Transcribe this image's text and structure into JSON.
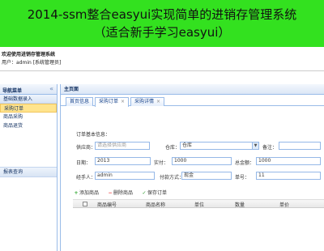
{
  "banner": {
    "line1": "2014-ssm整合easyui实现简单的进销存管理系统",
    "line2": "（适合新手学习easyui）"
  },
  "header": {
    "system_title": "欢迎使用进销存管理系统",
    "user_line": "用户：admin  [系统管理员]"
  },
  "sidebar": {
    "title": "导航菜单",
    "collapse_icon": "«",
    "items": [
      {
        "label": "基础数据录入",
        "group": true
      },
      {
        "label": "采购订单",
        "active": true
      },
      {
        "label": "商品采购"
      },
      {
        "label": "商品退货"
      }
    ],
    "bottom_group": "报表查询"
  },
  "main": {
    "title": "主页面",
    "tabs": [
      {
        "label": "首页信息"
      },
      {
        "label": "采购订单",
        "close": "×",
        "selected": true
      },
      {
        "label": "采购详情",
        "close": "×"
      }
    ]
  },
  "form": {
    "legend": "订单基本信息：",
    "supplier_label": "供应商：",
    "supplier_placeholder": "请选择供应商",
    "warehouse_label": "仓库：",
    "warehouse_value": "仓库",
    "remark_label": "备注：",
    "date_label": "日期：",
    "date_value": "2013",
    "payment_label": "实付：",
    "payment_value": "1000",
    "total_label": "总金额：",
    "total_value": "1000",
    "operator_label": "经手人：",
    "operator_value": "admin",
    "pay_method_label": "付款方式：",
    "pay_method_value": "现金",
    "number_label": "单号：",
    "number_value": "11"
  },
  "toolbar": {
    "add_label": "添加商品",
    "delete_label": "删除商品",
    "save_label": "保存订单"
  },
  "grid": {
    "columns": [
      "商品编号",
      "商品名称",
      "单位",
      "数量",
      "单价"
    ]
  },
  "colors": {
    "banner_bg": "#33e11f",
    "panel_border": "#99bbe8",
    "active_item": "#ffe48d"
  }
}
